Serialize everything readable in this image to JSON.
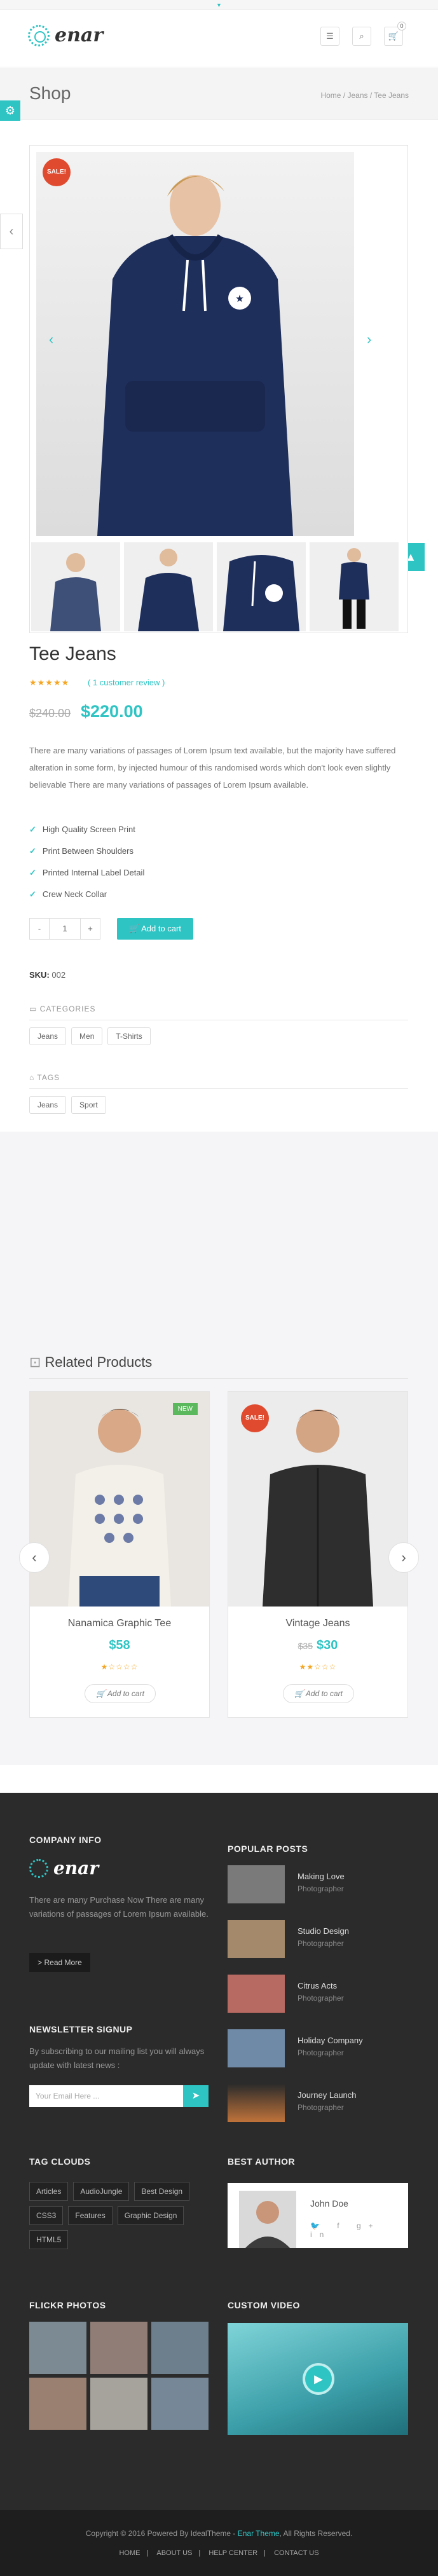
{
  "brand": {
    "name": "enar"
  },
  "header": {
    "menu_icon": "menu-icon",
    "search_icon": "search-icon",
    "cart_icon": "cart-icon",
    "cart_count": "0"
  },
  "titlebar": {
    "title": "Shop",
    "breadcrumb": "Home / Jeans / Tee Jeans"
  },
  "product": {
    "sale_badge": "SALE!",
    "title": "Tee Jeans",
    "rating": 5,
    "review_link": "( 1 customer review )",
    "old_price": "$240.00",
    "price": "$220.00",
    "description": "There are many variations of passages of Lorem Ipsum text available, but the majority have suffered alteration in some form, by injected humour of this randomised words which don't look even slightly believable There are many variations of passages of Lorem Ipsum available.",
    "features": [
      "High Quality Screen Print",
      "Print Between Shoulders",
      "Printed Internal Label Detail",
      "Crew Neck Collar"
    ],
    "qty_minus": "-",
    "quantity": "1",
    "qty_plus": "+",
    "add_to_cart": "Add to cart",
    "sku_label": "SKU:",
    "sku": "002",
    "categories_label": "CATEGORIES",
    "categories": [
      "Jeans",
      "Men",
      "T-Shirts"
    ],
    "tags_label": "TAGS",
    "tags": [
      "Jeans",
      "Sport"
    ]
  },
  "related": {
    "heading": "Related Products",
    "items": [
      {
        "badge": "NEW",
        "name": "Nanamica Graphic Tee",
        "price": "$58",
        "old_price": "",
        "rating": 1,
        "button": "Add to cart"
      },
      {
        "badge": "SALE!",
        "name": "Vintage Jeans",
        "price": "$30",
        "old_price": "$35",
        "rating": 2,
        "button": "Add to cart"
      }
    ]
  },
  "footer": {
    "company_heading": "COMPANY INFO",
    "company_text": "There are many Purchase Now There are many variations of passages of Lorem Ipsum available.",
    "read_more": "> Read More",
    "newsletter_heading": "NEWSLETTER SIGNUP",
    "newsletter_text": "By subscribing to our mailing list you will always update with latest news :",
    "email_placeholder": "Your Email Here ...",
    "popular_heading": "POPULAR POSTS",
    "posts": [
      {
        "title": "Making Love",
        "sub": "Photographer"
      },
      {
        "title": "Studio Design",
        "sub": "Photographer"
      },
      {
        "title": "Citrus Acts",
        "sub": "Photographer"
      },
      {
        "title": "Holiday Company",
        "sub": "Photographer"
      },
      {
        "title": "Journey Launch",
        "sub": "Photographer"
      }
    ],
    "tags_heading": "TAG CLOUDS",
    "tags": [
      "Articles",
      "AudioJungle",
      "Best Design",
      "CSS3",
      "Features",
      "Graphic Design",
      "HTML5"
    ],
    "author_heading": "BEST AUTHOR",
    "author_name": "John Doe",
    "author_social": "🐦 f g+ in",
    "flickr_heading": "FLICKR PHOTOS",
    "video_heading": "CUSTOM VIDEO",
    "copyright_prefix": "Copyright © 2016 Powered By IdealTheme - ",
    "copyright_brand": "Enar Theme",
    "copyright_suffix": ", All Rights Reserved.",
    "nav": [
      "HOME",
      "ABOUT US",
      "HELP CENTER",
      "CONTACT US"
    ]
  },
  "colors": {
    "accent": "#2ec4c4",
    "sale": "#e04a2e",
    "new": "#5cb85c",
    "footer_bg": "#2b2b2b"
  }
}
